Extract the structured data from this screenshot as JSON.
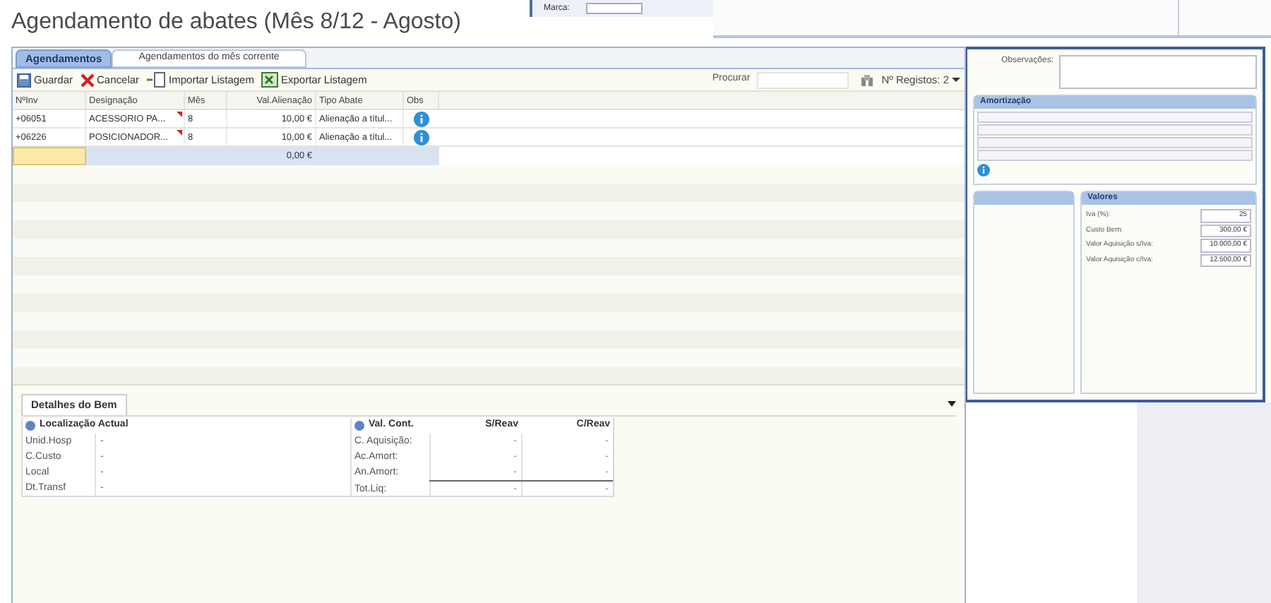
{
  "title": "Agendamento de abates (Mês 8/12 - Agosto)",
  "tabs": [
    {
      "label": "Agendamentos",
      "selected": true
    },
    {
      "label": "Agendamentos do mês corrente",
      "selected": false
    }
  ],
  "toolbar": {
    "buttons": [
      {
        "kind": "save",
        "label": "Guardar"
      },
      {
        "kind": "cancel",
        "label": "Cancelar"
      },
      {
        "kind": "import",
        "label": "Importar Listagem"
      },
      {
        "kind": "export",
        "label": "Exportar Listagem"
      }
    ],
    "search_label": "Procurar",
    "record_count": "Nº Registos: 2"
  },
  "grid": {
    "columns": [
      "NºInv",
      "Designação",
      "Mês",
      "Val.Alienação",
      "Tipo Abate",
      "Obs"
    ],
    "rows": [
      {
        "cells": [
          "+06051",
          "ACESSORIO PA...",
          "8",
          "10,00 €",
          "Alienação a títul..."
        ],
        "has_note": true
      },
      {
        "cells": [
          "+06226",
          "POSICIONADOR...",
          "8",
          "10,00 €",
          "Alienação a títul..."
        ],
        "has_note": true
      }
    ],
    "total": "0,00 €"
  },
  "details": {
    "tab": "Detalhes do Bem",
    "location": {
      "title": "Localização Actual",
      "rows": [
        {
          "label": "Unid.Hosp",
          "value": "-"
        },
        {
          "label": "C.Custo",
          "value": "-"
        },
        {
          "label": "Local",
          "value": "-"
        },
        {
          "label": "Dt.Transf",
          "value": "-"
        }
      ]
    },
    "values": {
      "title": "Val. Cont.",
      "columns": [
        "S/Reav",
        "C/Reav"
      ],
      "rows": [
        {
          "label": "C. Aquisição:",
          "s": "-",
          "c": "-"
        },
        {
          "label": "Ac.Amort:",
          "s": "-",
          "c": "-"
        },
        {
          "label": "An.Amort:",
          "s": "-",
          "c": "-"
        },
        {
          "label": "Tot.Liq:",
          "s": "-",
          "c": "-"
        }
      ]
    }
  },
  "background_window": {
    "top_label": "Marca:",
    "observations_label": "Observações:",
    "amortization_title": "Amortização",
    "values_title": "Valores",
    "values": [
      {
        "label": "Iva (%):",
        "value": "25"
      },
      {
        "label": "Custo Bem:",
        "value": "300,00 €"
      },
      {
        "label": "Valor Aquisição s/Iva:",
        "value": "10.000,00 €"
      },
      {
        "label": "Valor Aquisição c/Iva:",
        "value": "12.500,00 €"
      }
    ]
  }
}
